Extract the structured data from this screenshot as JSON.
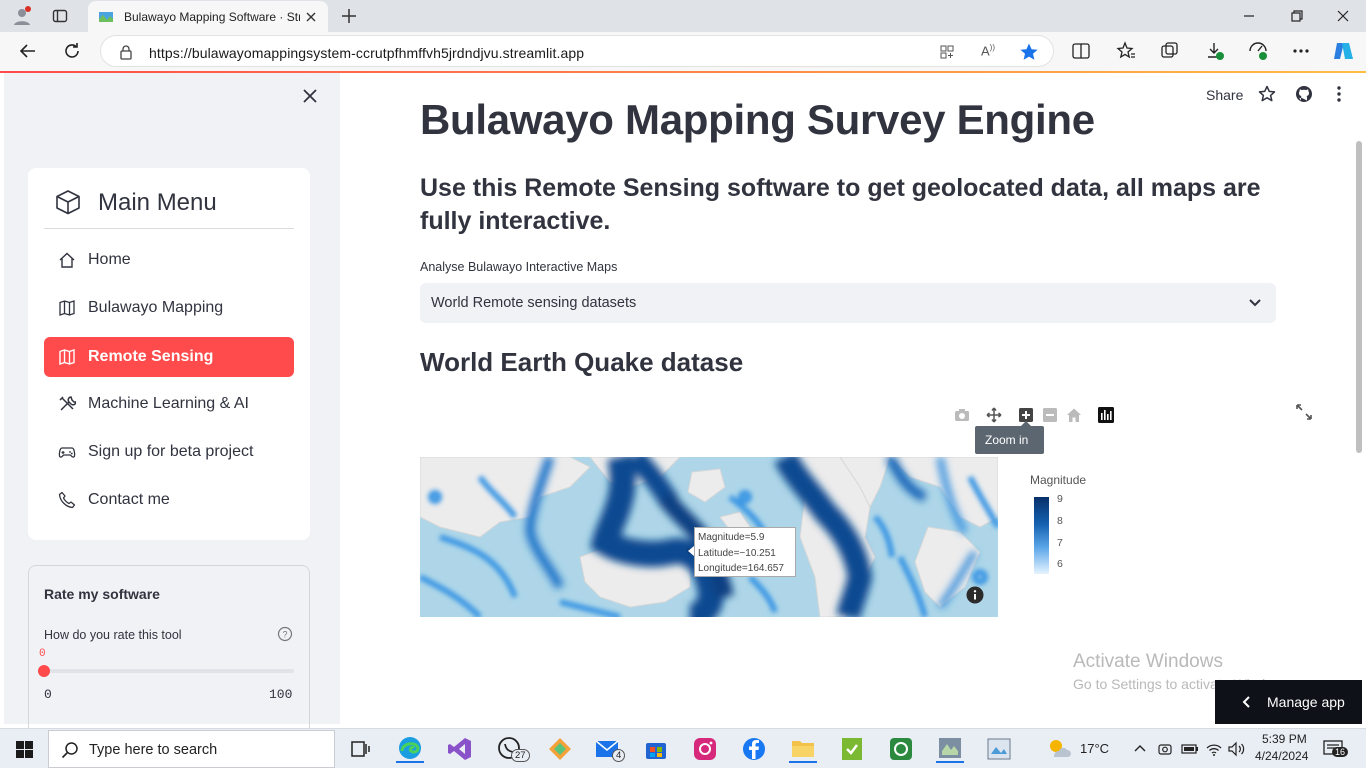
{
  "browser": {
    "tab_title": "Bulawayo Mapping Software · Str",
    "url": "https://bulawayomappingsystem-ccrutpfhmffvh5jrdndjvu.streamlit.app"
  },
  "header": {
    "share_label": "Share"
  },
  "sidebar": {
    "menu_title": "Main Menu",
    "items": [
      {
        "label": "Home",
        "icon": "house-icon",
        "active": false
      },
      {
        "label": "Bulawayo Mapping",
        "icon": "map-icon",
        "active": false
      },
      {
        "label": "Remote Sensing",
        "icon": "map-icon",
        "active": true
      },
      {
        "label": "Machine Learning & AI",
        "icon": "tools-icon",
        "active": false
      },
      {
        "label": "Sign up for beta project",
        "icon": "controller-icon",
        "active": false
      },
      {
        "label": "Contact me",
        "icon": "telephone-icon",
        "active": false
      }
    ],
    "rating": {
      "title": "Rate my software",
      "question": "How do you rate this tool",
      "value": "0",
      "min": "0",
      "max": "100",
      "value_fraction": 0
    }
  },
  "main": {
    "title": "Bulawayo Mapping Survey Engine",
    "subtitle": "Use this Remote Sensing software to get geolocated data, all maps are fully interactive.",
    "select_label": "Analyse Bulawayo Interactive Maps",
    "select_value": "World Remote sensing datasets",
    "section_title": "World Earth Quake datase",
    "tooltip_zoom": "Zoom in",
    "map_hover": {
      "line1": "Magnitude=5.9",
      "line2": "Latitude=−10.251",
      "line3": "Longitude=164.657"
    },
    "colorbar": {
      "title": "Magnitude",
      "ticks": [
        "9",
        "8",
        "7",
        "6"
      ]
    }
  },
  "watermark": {
    "line1": "Activate Windows",
    "line2": "Go to Settings to activate Windows."
  },
  "manage_app": "Manage app",
  "taskbar": {
    "search_placeholder": "Type here to search",
    "whatsapp_badge": "27",
    "mail_badge": "4",
    "weather": "17°C",
    "time": "5:39 PM",
    "date": "4/24/2024",
    "notifications": "16"
  }
}
